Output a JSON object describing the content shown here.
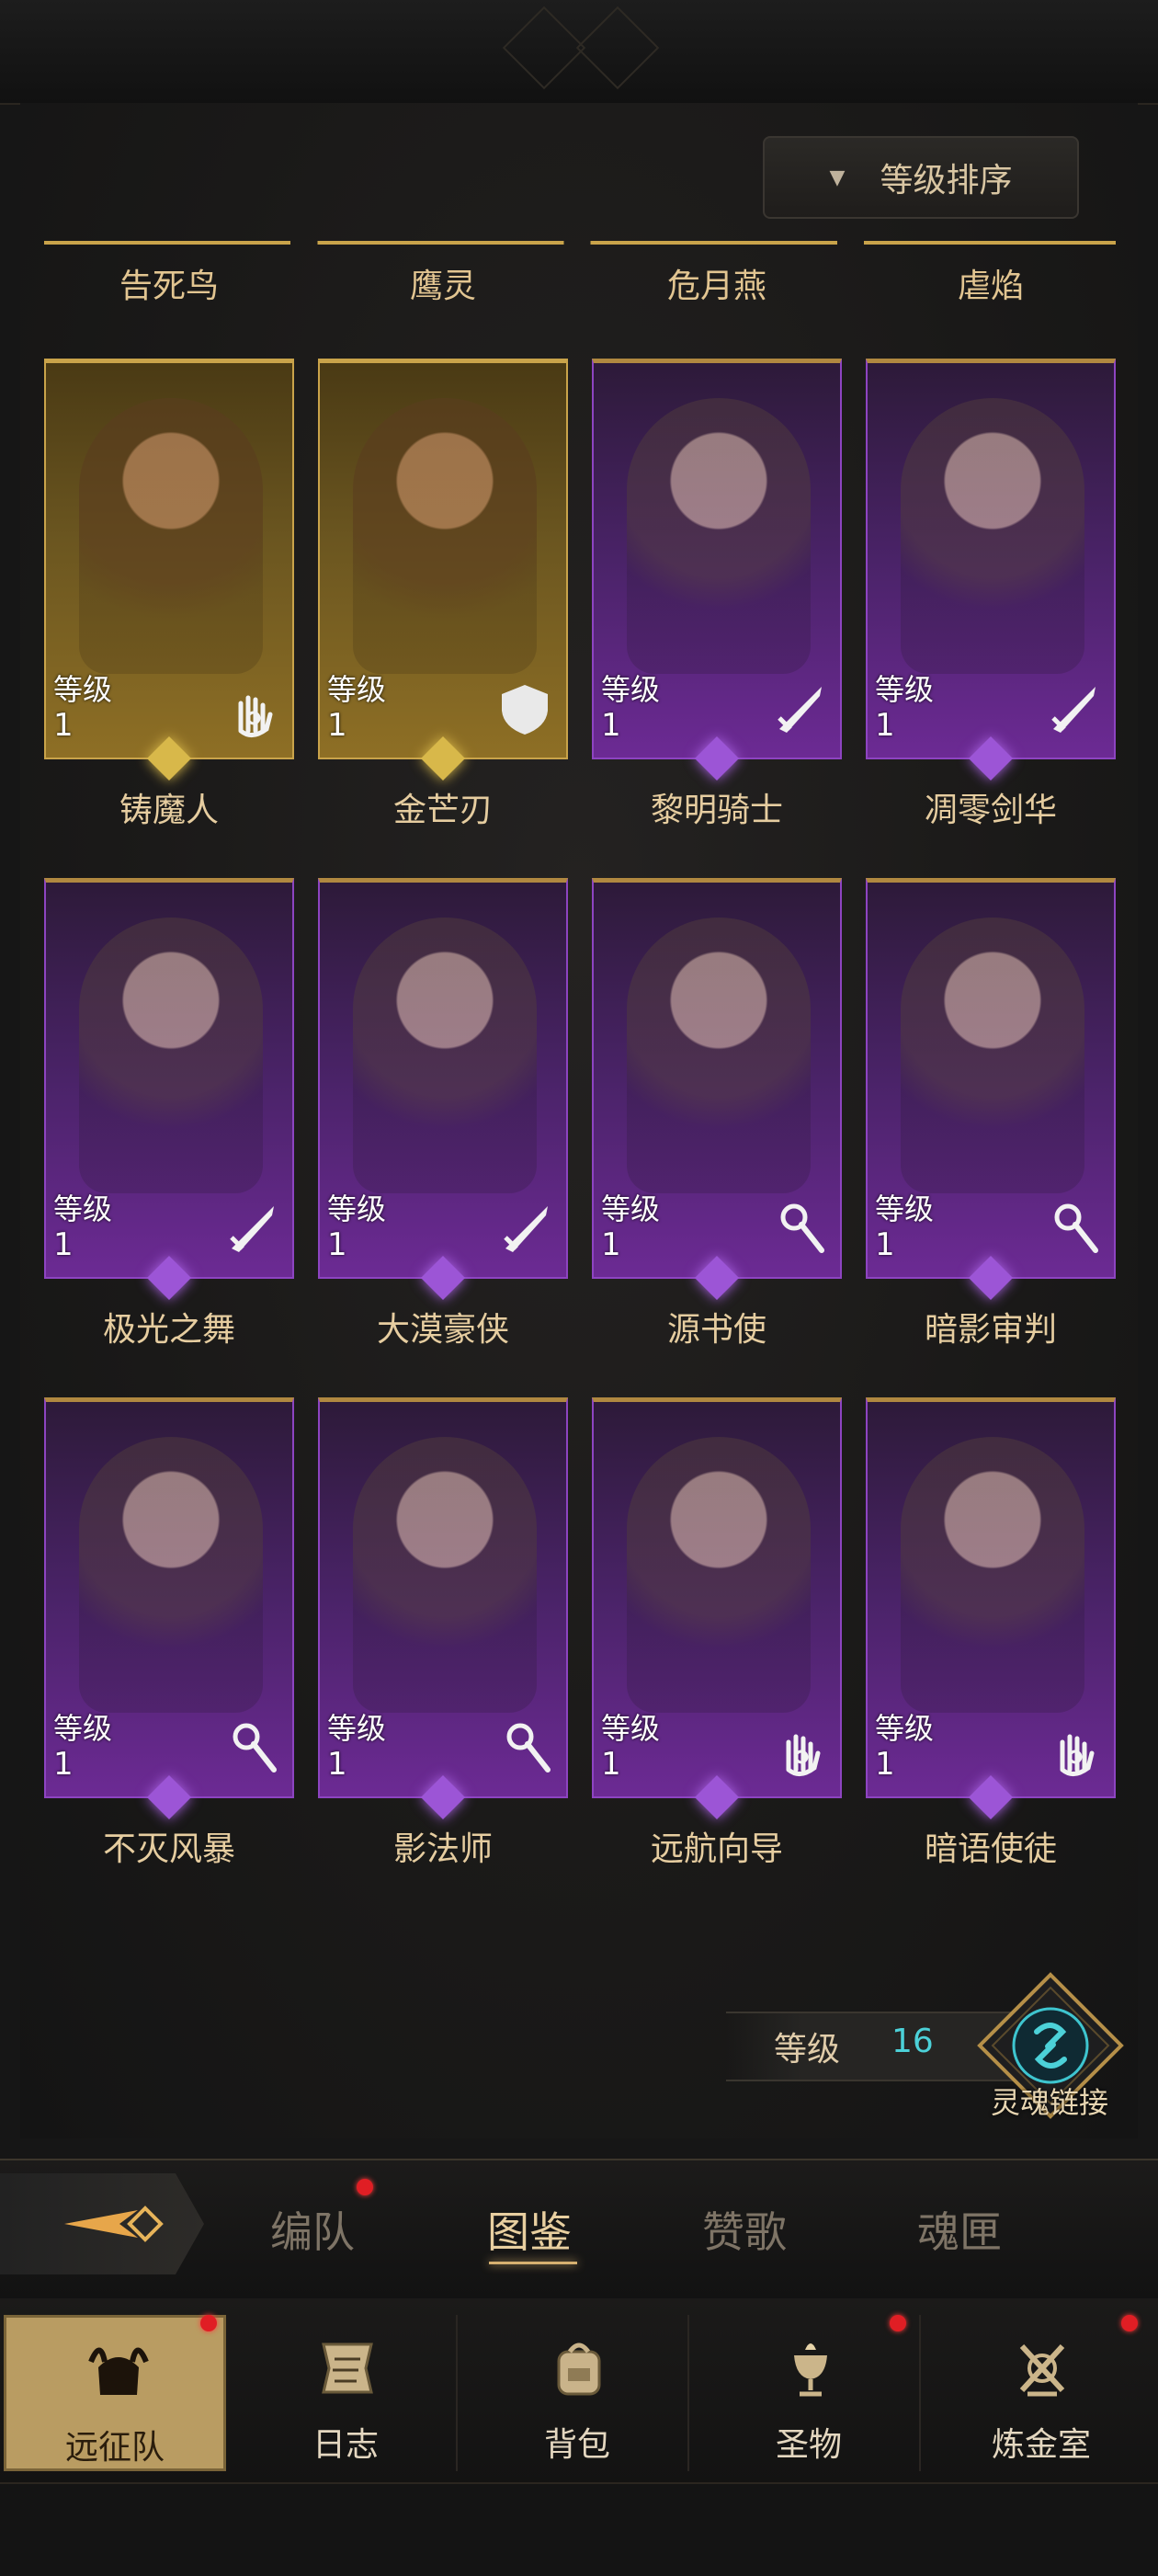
{
  "sort_button": {
    "label": "等级排序"
  },
  "top_row_names": [
    "告死鸟",
    "鹰灵",
    "危月燕",
    "虐焰"
  ],
  "level_label": "等级",
  "cards": [
    {
      "name": "铸魔人",
      "level": "1",
      "rarity": "gold",
      "class_icon": "hand-icon"
    },
    {
      "name": "金芒刃",
      "level": "1",
      "rarity": "gold",
      "class_icon": "shield-icon"
    },
    {
      "name": "黎明骑士",
      "level": "1",
      "rarity": "purple",
      "class_icon": "sword-icon"
    },
    {
      "name": "凋零剑华",
      "level": "1",
      "rarity": "purple",
      "class_icon": "sword-icon"
    },
    {
      "name": "极光之舞",
      "level": "1",
      "rarity": "purple",
      "class_icon": "sword-icon"
    },
    {
      "name": "大漠豪侠",
      "level": "1",
      "rarity": "purple",
      "class_icon": "sword-icon"
    },
    {
      "name": "源书使",
      "level": "1",
      "rarity": "purple",
      "class_icon": "staff-icon"
    },
    {
      "name": "暗影审判",
      "level": "1",
      "rarity": "purple",
      "class_icon": "staff-icon"
    },
    {
      "name": "不灭风暴",
      "level": "1",
      "rarity": "purple",
      "class_icon": "staff-icon"
    },
    {
      "name": "影法师",
      "level": "1",
      "rarity": "purple",
      "class_icon": "staff-icon"
    },
    {
      "name": "远航向导",
      "level": "1",
      "rarity": "purple",
      "class_icon": "hand-icon"
    },
    {
      "name": "暗语使徒",
      "level": "1",
      "rarity": "purple",
      "class_icon": "hand-icon"
    }
  ],
  "soul_link": {
    "level_label": "等级",
    "level_value": "16",
    "label": "灵魂链接"
  },
  "tabs": [
    {
      "label": "编队",
      "badge": true
    },
    {
      "label": "图鉴",
      "active": true
    },
    {
      "label": "赞歌"
    },
    {
      "label": "魂匣"
    }
  ],
  "bottom_nav": [
    {
      "label": "远征队",
      "active": true,
      "badge": true,
      "icon": "helmet-icon"
    },
    {
      "label": "日志",
      "icon": "scroll-icon"
    },
    {
      "label": "背包",
      "icon": "backpack-icon"
    },
    {
      "label": "圣物",
      "badge": true,
      "icon": "chalice-icon"
    },
    {
      "label": "炼金室",
      "badge": true,
      "icon": "alchemy-icon"
    }
  ],
  "colors": {
    "accent_gold": "#d4af52",
    "accent_purple": "#9c55d6",
    "level_cyan": "#4cd1d8",
    "badge_red": "#e01e24"
  }
}
